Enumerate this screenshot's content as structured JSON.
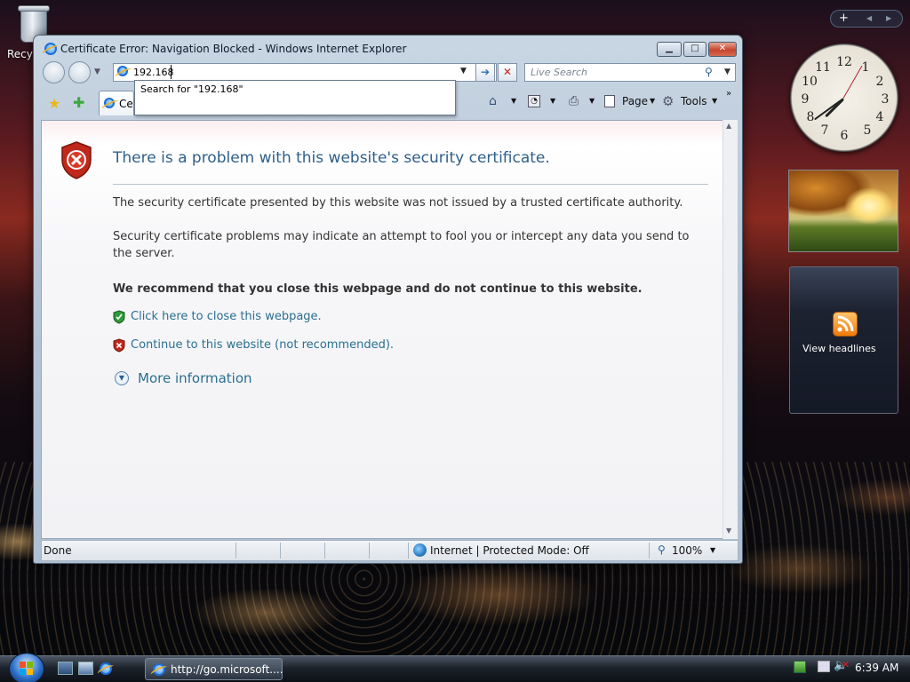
{
  "desktop": {
    "recycle_label": "Recyc"
  },
  "window": {
    "title": "Certificate Error: Navigation Blocked - Windows Internet Explorer",
    "address_value": "192.168",
    "autocomplete": "Search for \"192.168\"",
    "search_placeholder": "Live Search",
    "tab_label": "Ce",
    "toolbar": {
      "page_label": "Page",
      "tools_label": "Tools"
    }
  },
  "page": {
    "heading": "There is a problem with this website's security certificate.",
    "para1": "The security certificate presented by this website was not issued by a trusted certificate authority.",
    "para2": "Security certificate problems may indicate an attempt to fool you or intercept any data you send to the server.",
    "recommend": "We recommend that you close this webpage and do not continue to this website.",
    "close_link": "Click here to close this webpage.",
    "continue_link": "Continue to this website (not recommended).",
    "more_info": "More information"
  },
  "status": {
    "left": "Done",
    "zone": "Internet | Protected Mode: Off",
    "zoom": "100%"
  },
  "sidebar": {
    "plus": "+",
    "feed_label": "View headlines"
  },
  "taskbar": {
    "task_label": "http://go.microsoft....",
    "time": "6:39 AM"
  },
  "colors": {
    "link": "#2a6f8f",
    "heading": "#2f5f8a",
    "shield_red": "#c0281c",
    "shield_green": "#2f9a3a"
  }
}
